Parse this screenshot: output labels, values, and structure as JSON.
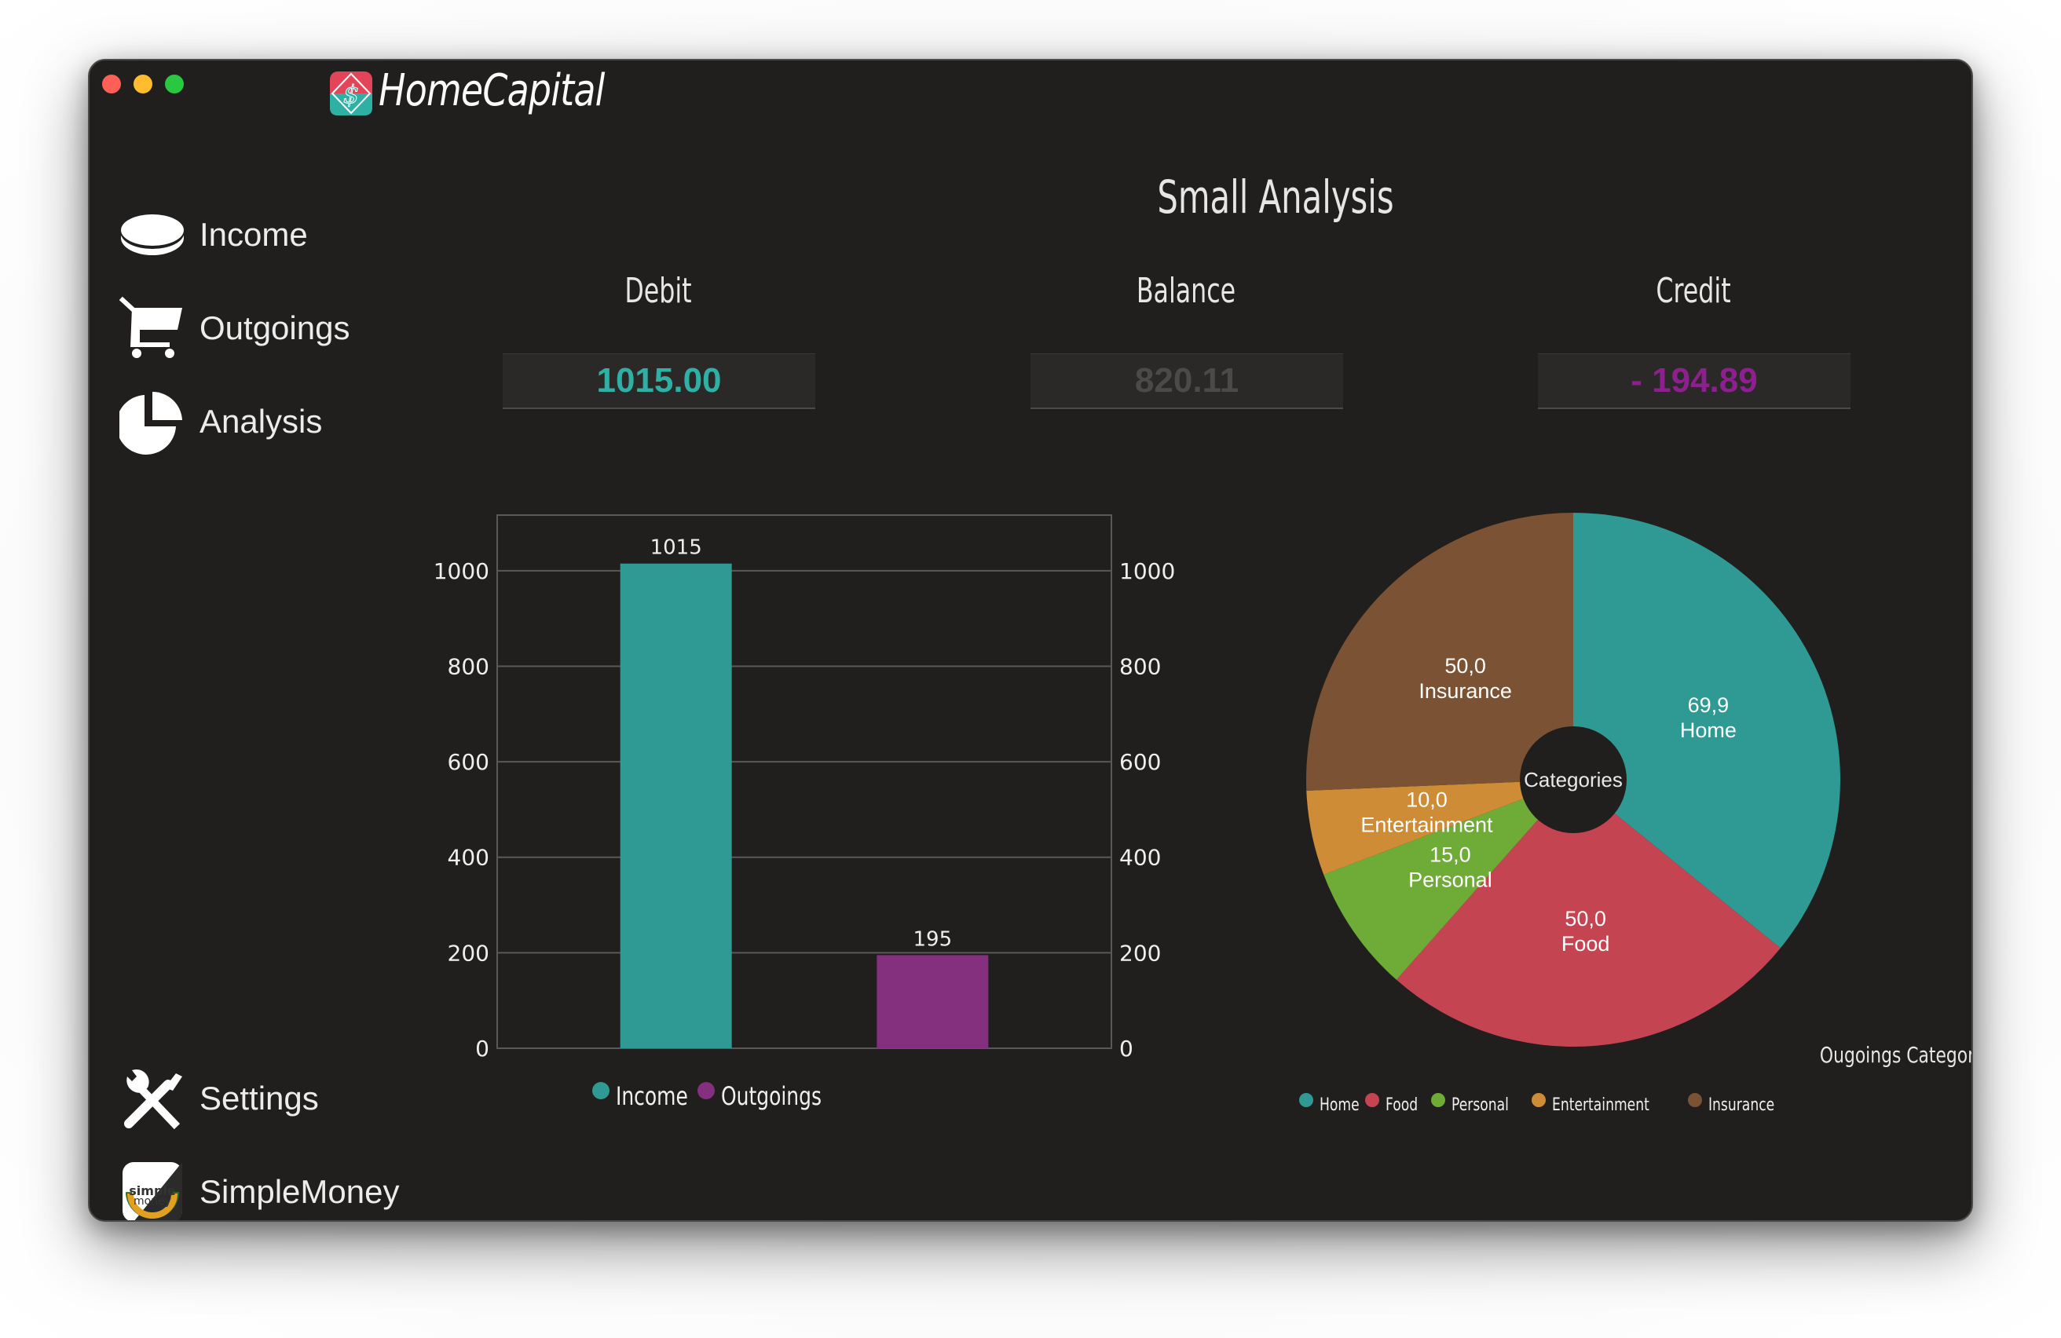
{
  "app": {
    "title": "HomeCapital",
    "logo_icon": "dollar-diamond-logo-icon"
  },
  "window_controls": [
    "close",
    "minimize",
    "zoom"
  ],
  "sidebar": {
    "items": [
      {
        "label": "Income",
        "icon": "coin-icon"
      },
      {
        "label": "Outgoings",
        "icon": "shopping-cart-icon"
      },
      {
        "label": "Analysis",
        "icon": "pie-chart-icon"
      }
    ],
    "bottom_items": [
      {
        "label": "Settings",
        "icon": "tools-icon"
      },
      {
        "label": "SimpleMoney",
        "icon": "simplemoney-app-icon"
      }
    ]
  },
  "main": {
    "title": "Small Analysis",
    "metrics": [
      {
        "label": "Debit",
        "value": "1015.00",
        "color": "#2fb0a5"
      },
      {
        "label": "Balance",
        "value": "820.11",
        "color": "#4a4a4a"
      },
      {
        "label": "Credit",
        "value": "- 194.89",
        "color": "#8e1f8e"
      }
    ]
  },
  "chart_data": [
    {
      "type": "bar",
      "title": "",
      "categories": [
        "Income",
        "Outgoings"
      ],
      "values": [
        1015,
        195
      ],
      "data_labels": [
        "1015",
        "195"
      ],
      "colors": [
        "#2e9a93",
        "#84307f"
      ],
      "yticks": [
        "0",
        "200",
        "400",
        "600",
        "800",
        "1000"
      ],
      "ytick_values": [
        0,
        200,
        400,
        600,
        800,
        1000
      ],
      "ylim": [
        0,
        1116.5
      ],
      "secondary_y_axis": true,
      "grid": true,
      "legend": {
        "position": "bottom-left",
        "entries": [
          "Income",
          "Outgoings"
        ]
      }
    },
    {
      "type": "pie",
      "title": "Ougoings Category Chart",
      "center_label": "Categories",
      "categories": [
        "Home",
        "Food",
        "Personal",
        "Entertainment",
        "Insurance"
      ],
      "values": [
        69.9,
        50.0,
        15.0,
        10.0,
        50.0
      ],
      "value_labels": [
        "69,9",
        "50,0",
        "15,0",
        "10,0",
        "50,0"
      ],
      "colors": [
        "#2e9a93",
        "#c54452",
        "#6fac37",
        "#cd8c35",
        "#7b5233"
      ],
      "donut": true,
      "legend": {
        "position": "bottom",
        "entries": [
          "Home",
          "Food",
          "Personal",
          "Entertainment",
          "Insurance"
        ]
      }
    }
  ]
}
